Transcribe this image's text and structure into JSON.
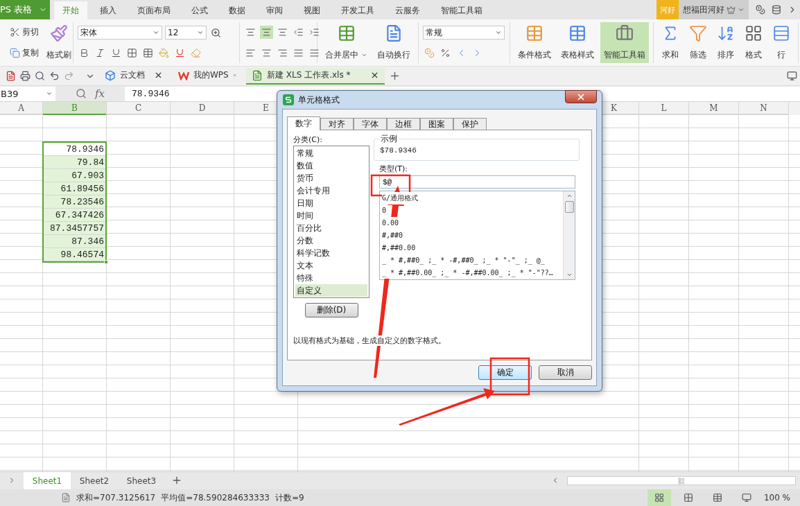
{
  "app_button": {
    "label": "PS 表格"
  },
  "menu_tabs": [
    {
      "label": "开始",
      "selected": true
    },
    {
      "label": "插入",
      "selected": false
    },
    {
      "label": "页面布局",
      "selected": false
    },
    {
      "label": "公式",
      "selected": false
    },
    {
      "label": "数据",
      "selected": false
    },
    {
      "label": "审阅",
      "selected": false
    },
    {
      "label": "视图",
      "selected": false
    },
    {
      "label": "开发工具",
      "selected": false
    },
    {
      "label": "云服务",
      "selected": false
    },
    {
      "label": "智能工具箱",
      "selected": false
    }
  ],
  "user": {
    "badge": "河好",
    "name": "想福田河好"
  },
  "ribbon": {
    "cut": "剪切",
    "copy": "复制",
    "format_painter": "格式刷",
    "font_name": "宋体",
    "font_size": "12",
    "merge": "合并居中",
    "wrap": "自动换行",
    "number_format": "常规",
    "tools": [
      {
        "label": "条件格式",
        "active": false
      },
      {
        "label": "表格样式",
        "active": false
      },
      {
        "label": "智能工具箱",
        "active": true
      }
    ],
    "edit_tools": [
      {
        "kind": "sum",
        "label": "求和"
      },
      {
        "kind": "filter",
        "label": "筛选"
      },
      {
        "kind": "sort",
        "label": "排序"
      },
      {
        "kind": "format",
        "label": "格式"
      },
      {
        "kind": "row",
        "label": "行"
      }
    ]
  },
  "doc_tabs": [
    {
      "kind": "cloud",
      "label": "云文档",
      "selected": false
    },
    {
      "kind": "wps",
      "label": "我的WPS",
      "selected": false
    },
    {
      "kind": "sheet",
      "label": "新建 XLS 工作表.xls *",
      "selected": true
    }
  ],
  "formula_bar": {
    "cell": "B39",
    "fx_label": "fx",
    "value": "78.9346"
  },
  "sheet": {
    "columns": [
      {
        "label": "A",
        "selected": false
      },
      {
        "label": "B",
        "selected": true
      },
      {
        "label": "C",
        "selected": false
      },
      {
        "label": "D",
        "selected": false
      },
      {
        "label": "E",
        "selected": false
      },
      {
        "label": "K",
        "selected": false
      },
      {
        "label": "L",
        "selected": false
      },
      {
        "label": "M",
        "selected": false
      },
      {
        "label": "N",
        "selected": false
      }
    ],
    "cells": [
      {
        "value": "78.9346",
        "active": true
      },
      {
        "value": "79.84",
        "active": false
      },
      {
        "value": "67.903",
        "active": false
      },
      {
        "value": "61.89456",
        "active": false
      },
      {
        "value": "78.23546",
        "active": false
      },
      {
        "value": "67.347426",
        "active": false
      },
      {
        "value": "87.3457757",
        "active": false
      },
      {
        "value": "87.346",
        "active": false
      },
      {
        "value": "98.46574",
        "active": false
      }
    ]
  },
  "dialog": {
    "title": "单元格格式",
    "tabs": [
      {
        "label": "数字",
        "selected": true
      },
      {
        "label": "对齐",
        "selected": false
      },
      {
        "label": "字体",
        "selected": false
      },
      {
        "label": "边框",
        "selected": false
      },
      {
        "label": "图案",
        "selected": false
      },
      {
        "label": "保护",
        "selected": false
      }
    ],
    "category_label": "分类(C):",
    "categories": [
      {
        "label": "常规",
        "selected": false
      },
      {
        "label": "数值",
        "selected": false
      },
      {
        "label": "货币",
        "selected": false
      },
      {
        "label": "会计专用",
        "selected": false
      },
      {
        "label": "日期",
        "selected": false
      },
      {
        "label": "时间",
        "selected": false
      },
      {
        "label": "百分比",
        "selected": false
      },
      {
        "label": "分数",
        "selected": false
      },
      {
        "label": "科学记数",
        "selected": false
      },
      {
        "label": "文本",
        "selected": false
      },
      {
        "label": "特殊",
        "selected": false
      },
      {
        "label": "自定义",
        "selected": true
      }
    ],
    "delete_button": "删除(D)",
    "sample_label": "示例",
    "sample_value": "$78.9346",
    "type_label": "类型(T):",
    "type_value": "$@",
    "formats": [
      "G/通用格式",
      "0",
      "0.00",
      "#,##0",
      "#,##0.00",
      "_ * #,##0_ ;_ * -#,##0_ ;_ * \"-\"_ ;_ @_",
      "_ * #,##0.00_ ;_ * -#,##0.00_ ;_ * \"-\"??…"
    ],
    "description": "以现有格式为基础，生成自定义的数字格式。",
    "buttons": [
      {
        "label": "确定",
        "default": true
      },
      {
        "label": "取消",
        "default": false
      }
    ]
  },
  "sheet_tabs": [
    {
      "label": "Sheet1",
      "selected": true
    },
    {
      "label": "Sheet2",
      "selected": false
    },
    {
      "label": "Sheet3",
      "selected": false
    }
  ],
  "status_bar": {
    "sum": "求和=707.3125617",
    "average": "平均值=78.590284633333",
    "count": "计数=9",
    "zoom": "100 %"
  }
}
